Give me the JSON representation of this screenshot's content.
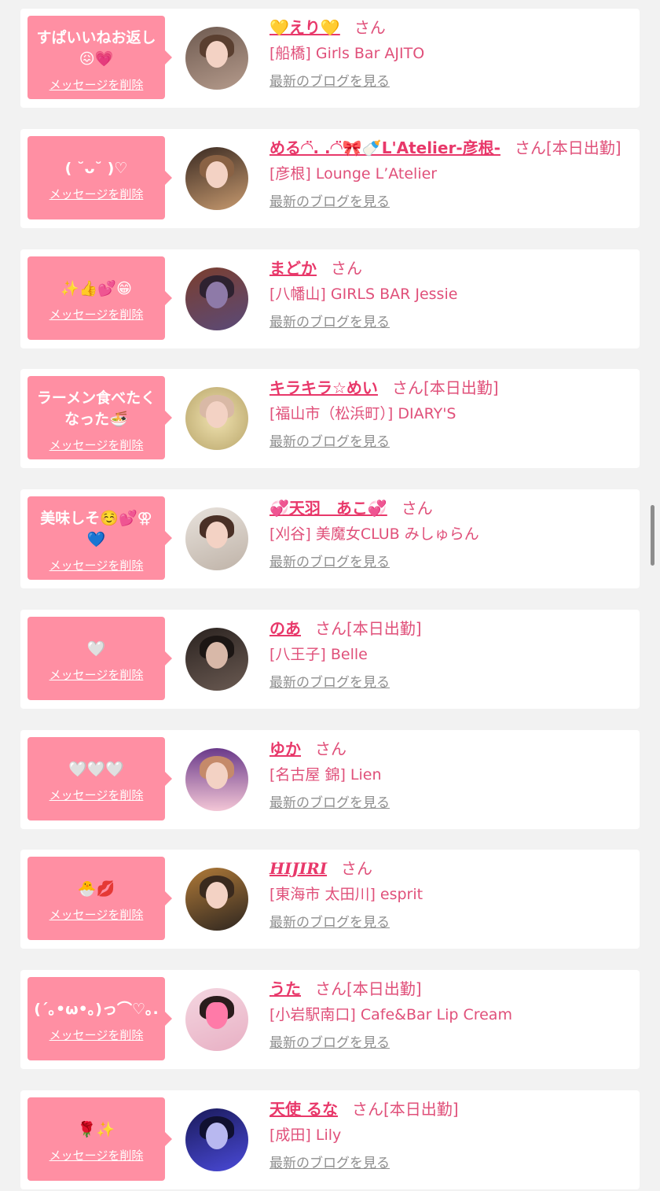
{
  "delete_label": "メッセージを削除",
  "blog_label": "最新のブログを見る",
  "san_label": "さん",
  "today_label": "[本日出勤]",
  "colors": {
    "bubble": "#ff8fa3",
    "name": "#e8386a",
    "text": "#e0507a",
    "link_gray": "#8f8f8f",
    "background": "#f2f2f2"
  },
  "cards": [
    {
      "message": "すぱいいねお返し😖💗",
      "name": "💛えり💛",
      "shop": "[船橋] Girls Bar AJITO",
      "today": ""
    },
    {
      "message": "( ˘ᴗ˘ )♡",
      "name": "める◠̈. .◠̈🎀🍼L'Atelier-彦根-",
      "shop": "[彦根] Lounge L’Atelier",
      "today": "[本日出勤]"
    },
    {
      "message": "✨👍💕😁",
      "name": "まどか",
      "shop": "[八幡山] GIRLS BAR Jessie",
      "today": ""
    },
    {
      "message": "ラーメン食べたくなった🍜",
      "name": "キラキラ☆めい",
      "shop": "[福山市（松浜町）] DIARY'S",
      "today": "[本日出勤]"
    },
    {
      "message": "美味しそ☺️💕⚢💙",
      "name": "💞天羽　あこ💞",
      "shop": "[刈谷] 美魔女CLUB みしゅらん",
      "today": ""
    },
    {
      "message": "🤍",
      "name": "のあ",
      "shop": "[八王子] Belle",
      "today": "[本日出勤]"
    },
    {
      "message": "🤍🤍🤍",
      "name": "ゆか",
      "shop": "[名古屋 錦] Lien",
      "today": ""
    },
    {
      "message": "🐣💋",
      "name": "HIJIRI",
      "shop": "[東海市 太田川] esprit",
      "today": ""
    },
    {
      "message": "(´｡•ω•｡)っ⌒♡｡.",
      "name": "うた",
      "shop": "[小岩駅南口] Cafe&Bar Lip Cream",
      "today": "[本日出勤]"
    },
    {
      "message": "🌹✨",
      "name": "天使 るな",
      "shop": "[成田] Lily",
      "today": "[本日出勤]"
    }
  ]
}
